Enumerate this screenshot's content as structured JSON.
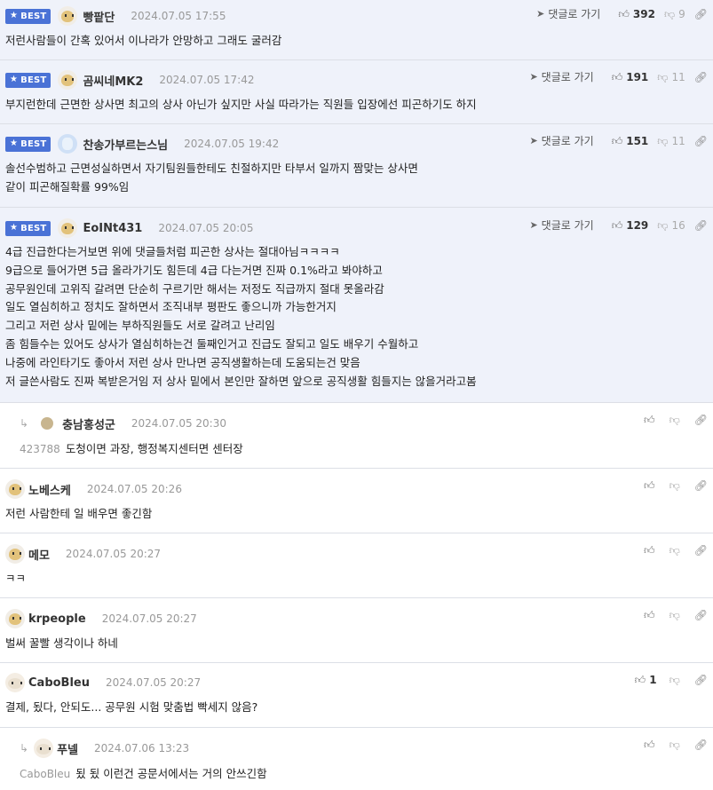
{
  "ui": {
    "best_label": "BEST",
    "reply_label": "댓글로 가기"
  },
  "comments": [
    {
      "nick": "빵팥단",
      "date": "2024.07.05 17:55",
      "up": "392",
      "down": "9",
      "lines": [
        "저런사람들이 간혹 있어서 이나라가 안망하고 그래도 굴러감"
      ]
    },
    {
      "nick": "곰씨네MK2",
      "date": "2024.07.05 17:42",
      "up": "191",
      "down": "11",
      "lines": [
        "부지런한데 근면한 상사면 최고의 상사 아닌가 싶지만 사실 따라가는 직원들 입장에선 피곤하기도 하지"
      ]
    },
    {
      "nick": "찬송가부르는스님",
      "date": "2024.07.05 19:42",
      "up": "151",
      "down": "11",
      "lines": [
        "솔선수범하고 근면성실하면서 자기팀원들한테도 친절하지만 타부서 일까지 짬맞는 상사면",
        "같이 피곤해질확률 99%임"
      ]
    },
    {
      "nick": "EoINt431",
      "date": "2024.07.05 20:05",
      "up": "129",
      "down": "16",
      "lines": [
        "4급 진급한다는거보면 위에 댓글들처럼 피곤한 상사는 절대아님ㅋㅋㅋㅋ",
        "9급으로 들어가면 5급 올라가기도 힘든데 4급 다는거면 진짜 0.1%라고 봐야하고",
        "공무원인데 고위직 갈려면 단순히 구르기만 해서는 저정도 직급까지 절대 못올라감",
        "일도 열심히하고 정치도 잘하면서 조직내부 평판도 좋으니까 가능한거지",
        "그리고 저런 상사 밑에는 부하직원들도 서로 갈려고 난리임",
        "좀 힘들수는 있어도 상사가 열심히하는건 둘째인거고 진급도 잘되고 일도 배우기 수월하고",
        "나중에 라인타기도 좋아서 저런 상사 만나면 공직생활하는데 도움되는건 맞음",
        "저 글쓴사람도 진짜 복받은거임 저 상사 밑에서 본인만 잘하면 앞으로 공직생활 힘들지는 않을거라고봄"
      ]
    },
    {
      "nick": "충남홍성군",
      "date": "2024.07.05 20:30",
      "target": "423788",
      "text": "도청이면 과장, 행정복지센터면 센터장"
    },
    {
      "nick": "노베스케",
      "date": "2024.07.05 20:26",
      "text": "저런 사람한테 일 배우면 좋긴함"
    },
    {
      "nick": "메모",
      "date": "2024.07.05 20:27",
      "text": "ㅋㅋ"
    },
    {
      "nick": "krpeople",
      "date": "2024.07.05 20:27",
      "text": "벌써 꿀빨 생각이나 하네"
    },
    {
      "nick": "CaboBleu",
      "date": "2024.07.05 20:27",
      "up": "1",
      "text": "결제, 됬다, 안되도... 공무원 시험 맞춤법 빡세지 않음?"
    },
    {
      "nick": "푸넬",
      "date": "2024.07.06 13:23",
      "target": "CaboBleu",
      "text": "됬 됬 이런건 공문서에서는 거의 안쓰긴함"
    }
  ],
  "icons": [
    "star-icon",
    "reply-arrow-icon",
    "thumbs-up-icon",
    "thumbs-down-icon",
    "link-icon",
    "reply-indent-icon"
  ]
}
